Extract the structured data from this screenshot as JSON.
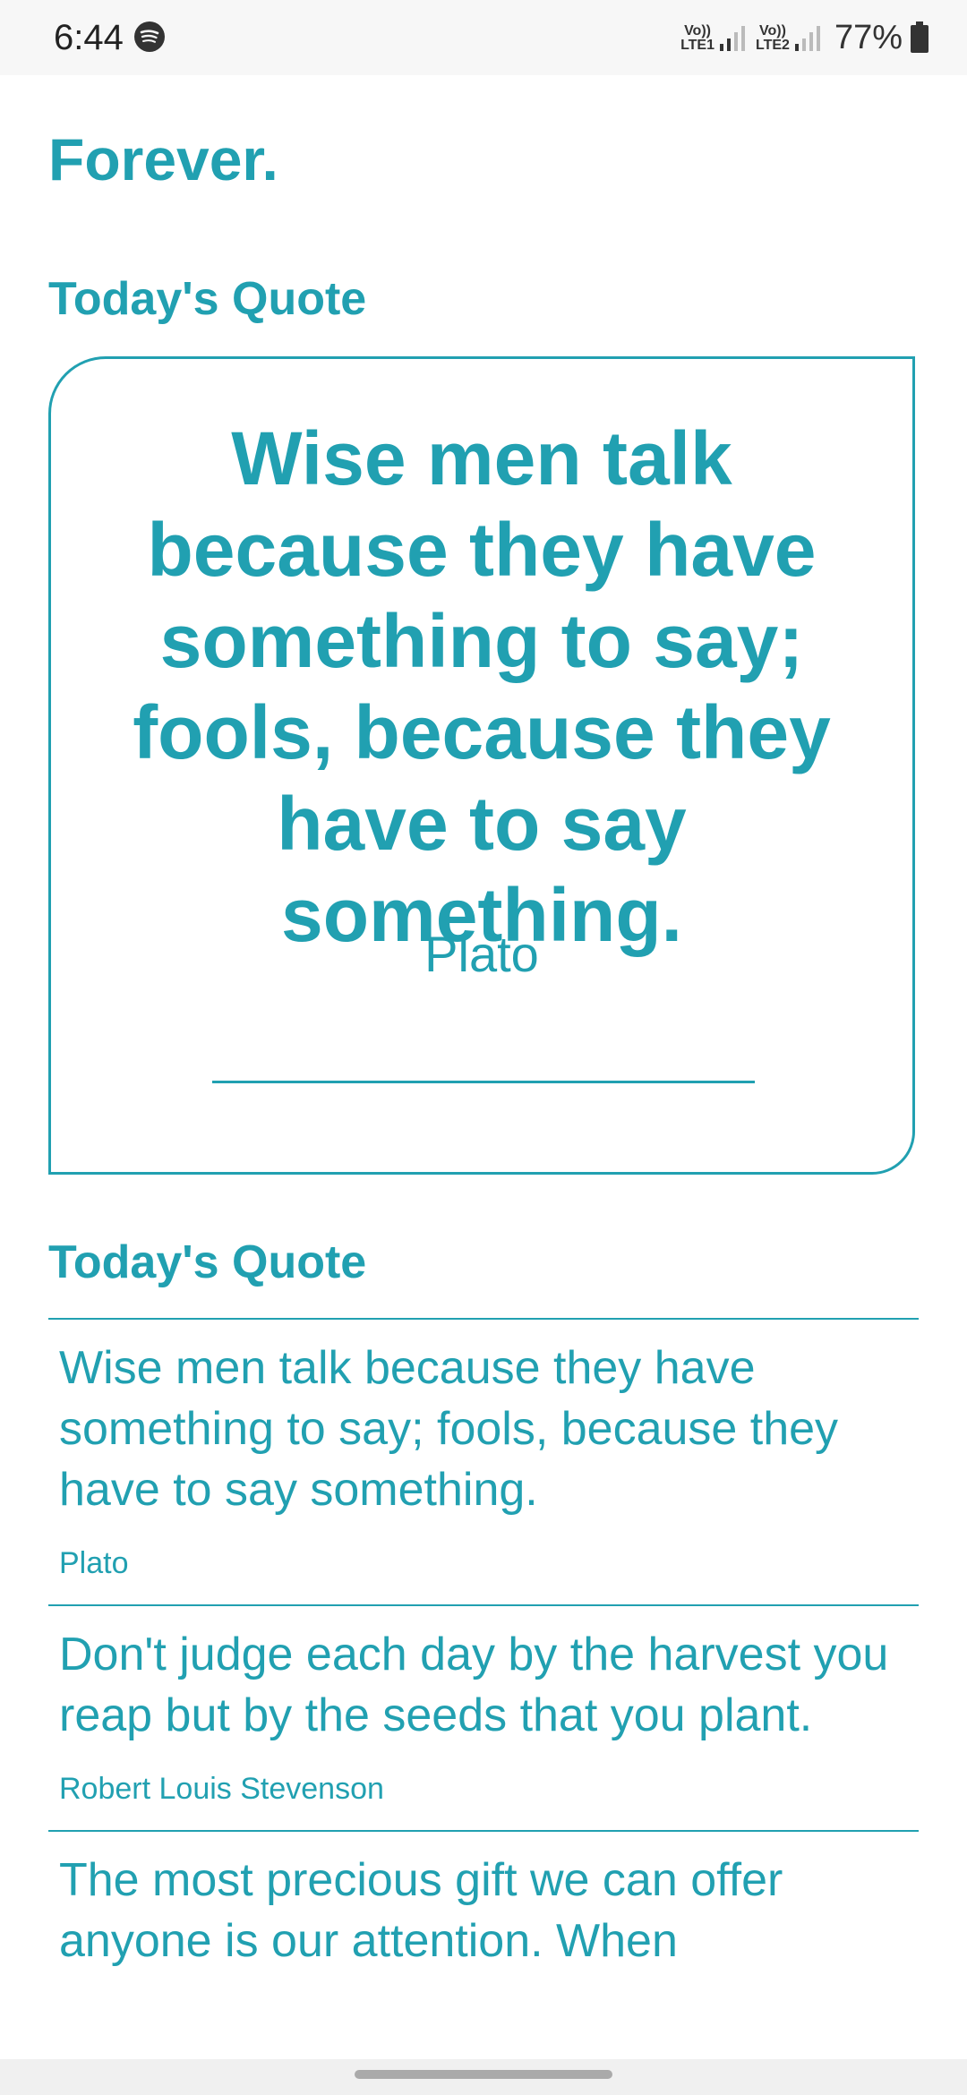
{
  "status_bar": {
    "time": "6:44",
    "lte1": "Vo))\nLTE1",
    "lte2": "Vo))\nLTE2",
    "battery": "77%"
  },
  "app": {
    "title": "Forever."
  },
  "featured": {
    "section_title": "Today's Quote",
    "quote": "Wise men talk because they have something to say; fools, because they have to say something.",
    "author": "Plato"
  },
  "list": {
    "section_title": "Today's Quote",
    "items": [
      {
        "text": "Wise men talk because they have something to say; fools, because they have to say something.",
        "author": "Plato"
      },
      {
        "text": "Don't judge each day by the harvest you reap but by the seeds that you plant.",
        "author": "Robert Louis Stevenson"
      },
      {
        "text": "The most precious gift we can offer anyone is our attention. When",
        "author": ""
      }
    ]
  }
}
